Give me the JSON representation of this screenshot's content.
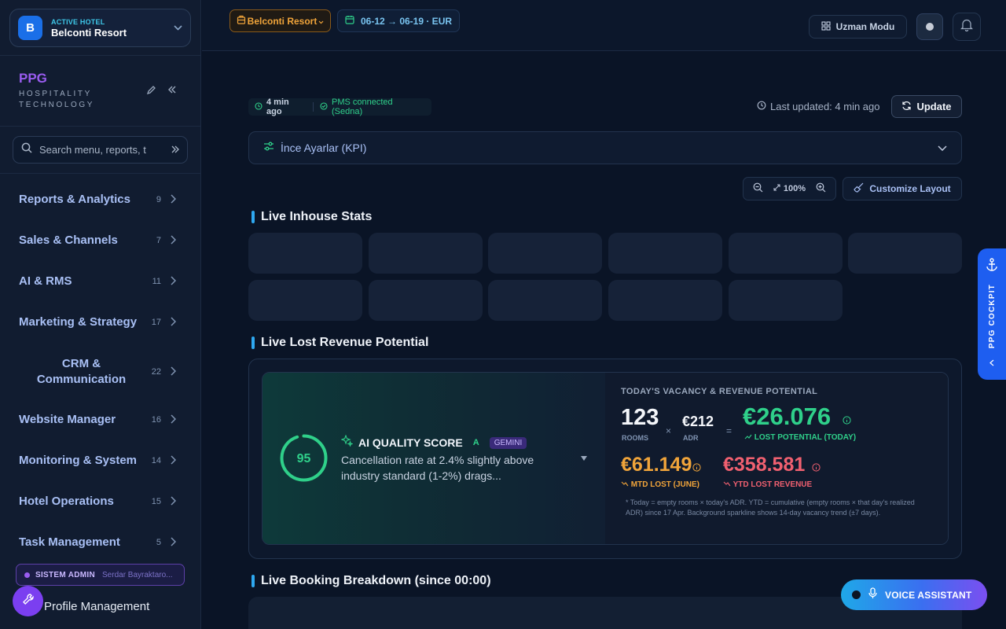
{
  "sidebar": {
    "hotel": {
      "overline": "ACTIVE HOTEL",
      "name": "Belconti Resort",
      "badge": "B"
    },
    "brand": {
      "name": "PPG",
      "subtitle_line1": "HOSPITALITY",
      "subtitle_line2": "TECHNOLOGY"
    },
    "search": {
      "placeholder": "Search menu, reports, t"
    },
    "menu": [
      {
        "label": "Reports & Analytics",
        "count": "9"
      },
      {
        "label": "Sales & Channels",
        "count": "7"
      },
      {
        "label": "AI & RMS",
        "count": "11"
      },
      {
        "label": "Marketing & Strategy",
        "count": "17"
      },
      {
        "label": "CRM & Communication",
        "count": "22"
      },
      {
        "label": "Website Manager",
        "count": "16"
      },
      {
        "label": "Monitoring & System",
        "count": "14"
      },
      {
        "label": "Hotel Operations",
        "count": "15"
      },
      {
        "label": "Task Management",
        "count": "5"
      }
    ],
    "admin": {
      "role": "SISTEM ADMIN",
      "user": "Serdar Bayraktaro..."
    },
    "profile_label": "Profile Management"
  },
  "topbar": {
    "resort": "Belconti Resort",
    "date_range": "06-12 → 06-19 · EUR",
    "expert_mode": "Uzman Modu"
  },
  "status": {
    "time_ago": "4 min ago",
    "pms": "PMS connected (Sedna)",
    "last_updated": "Last updated: 4 min ago",
    "update_label": "Update"
  },
  "kpi": {
    "label": "İnce Ayarlar (KPI)"
  },
  "zoom": {
    "level": "100%"
  },
  "customize_label": "Customize Layout",
  "sections": {
    "inhouse": "Live Inhouse Stats",
    "lost": "Live Lost Revenue Potential",
    "booking": "Live Booking Breakdown (since 00:00)"
  },
  "ai": {
    "score": "95",
    "score_value": 0.95,
    "title": "AI QUALITY SCORE",
    "grade": "A",
    "engine": "GEMINI",
    "text": "Cancellation rate at 2.4% slightly above industry standard (1-2%) drags..."
  },
  "vacancy": {
    "header": "TODAY'S VACANCY & REVENUE POTENTIAL",
    "rooms": "123",
    "rooms_label": "ROOMS",
    "adr": "€212",
    "adr_label": "ADR",
    "times": "×",
    "equals": "=",
    "lost_potential": "€26.076",
    "lost_potential_label": "LOST POTENTIAL (TODAY)",
    "mtd": "€61.149",
    "mtd_label": "MTD LOST (JUNE)",
    "ytd": "€358.581",
    "ytd_label": "YTD LOST REVENUE",
    "footnote": "* Today = empty rooms × today's ADR. YTD = cumulative (empty rooms × that day's realized ADR) since 17 Apr. Background sparkline shows 14-day vacancy trend (±7 days)."
  },
  "cockpit": {
    "label": "PPG COCKPIT"
  },
  "voice": {
    "label": "VOICE ASSISTANT"
  },
  "colors": {
    "accent_blue": "#2ea8f0",
    "brand_purple": "#9a5cf0",
    "green": "#2fd08a",
    "orange": "#f0a43a",
    "red": "#f06070"
  }
}
